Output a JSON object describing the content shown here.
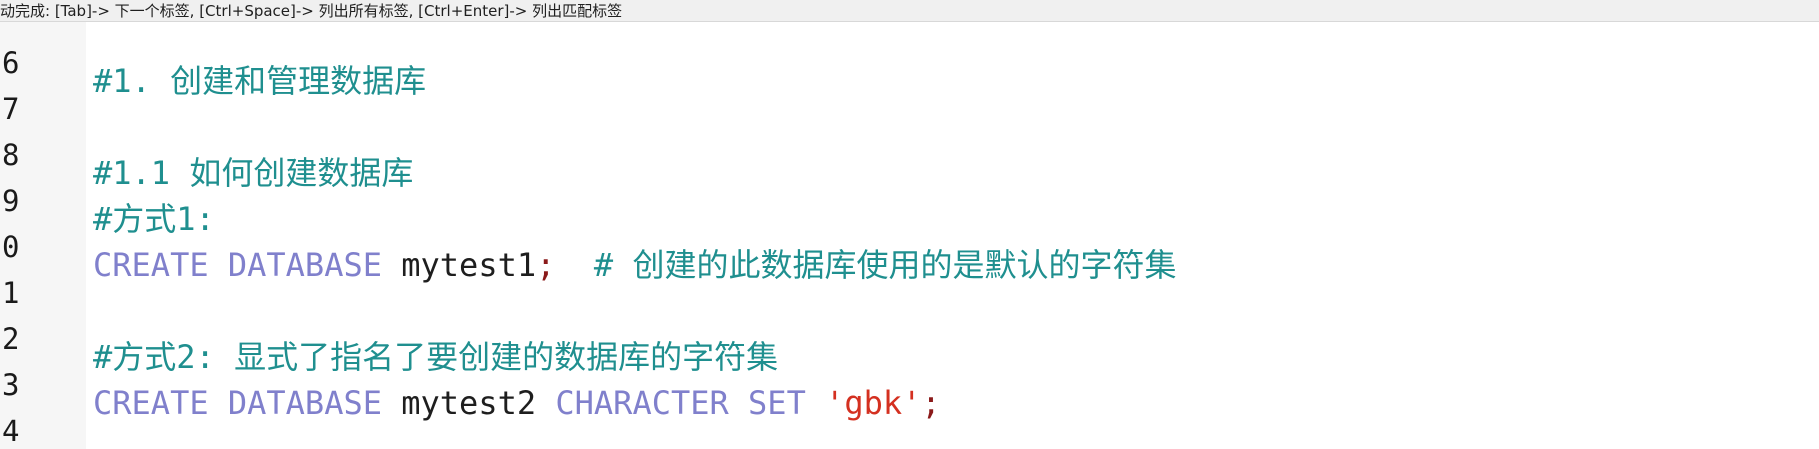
{
  "hint_bar": {
    "text": "动完成: [Tab]-> 下一个标签, [Ctrl+Space]-> 列出所有标签, [Ctrl+Enter]-> 列出匹配标签"
  },
  "lines": [
    {
      "number": "6",
      "comment": "#1. 创建和管理数据库"
    },
    {
      "number": "7"
    },
    {
      "number": "8",
      "comment": "#1.1 如何创建数据库"
    },
    {
      "number": "9",
      "comment": "#方式1:"
    },
    {
      "number": "0",
      "kw1": "CREATE",
      "kw2": "DATABASE",
      "ident": "mytest1",
      "semi": ";",
      "comment": "# 创建的此数据库使用的是默认的字符集"
    },
    {
      "number": "1"
    },
    {
      "number": "2",
      "comment": "#方式2: 显式了指名了要创建的数据库的字符集"
    },
    {
      "number": "3",
      "kw1": "CREATE",
      "kw2": "DATABASE",
      "ident": "mytest2",
      "kw3": "CHARACTER",
      "kw4": "SET",
      "string": "'gbk'",
      "semi": ";"
    },
    {
      "number": "4"
    }
  ],
  "colors": {
    "comment": "#1f8f8f",
    "keyword": "#8080cc",
    "identifier": "#1e1e1e",
    "string": "#d43020",
    "punctuation": "#8b1a1a",
    "gutter_bg": "#f6f6f6",
    "hint_bg": "#f0f0f0"
  }
}
